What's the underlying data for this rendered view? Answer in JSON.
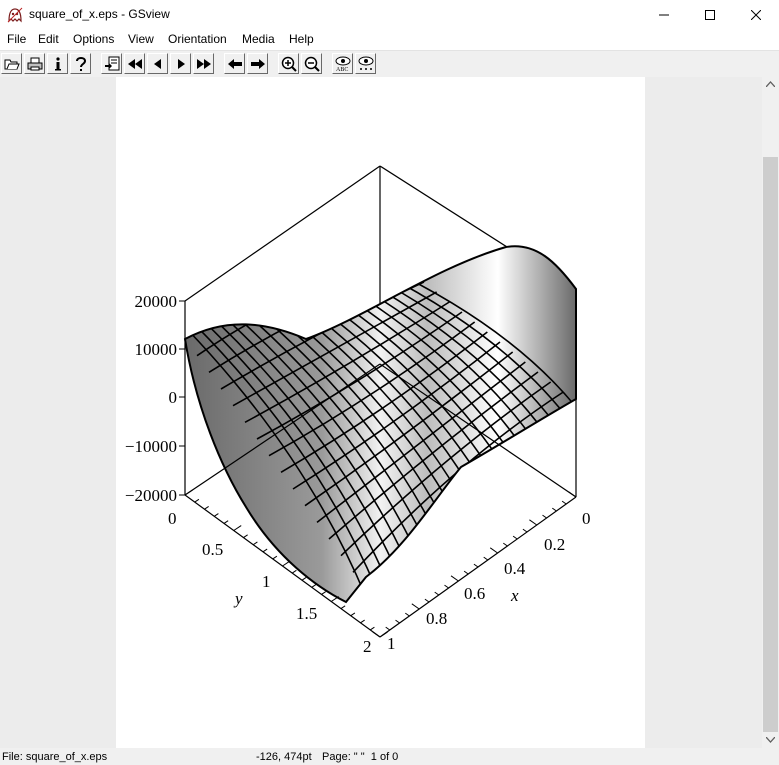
{
  "window": {
    "title": "square_of_x.eps - GSview"
  },
  "menu": [
    "File",
    "Edit",
    "Options",
    "View",
    "Orientation",
    "Media",
    "Help"
  ],
  "toolbar": {
    "buttons": [
      "open-icon",
      "print-icon",
      "info-icon",
      "help-icon",
      "goto-page-icon",
      "first-page-icon",
      "prev-page-icon",
      "next-page-icon",
      "last-page-icon",
      "back-icon",
      "forward-icon",
      "zoom-in-icon",
      "zoom-out-icon",
      "eye-text-icon",
      "eye-dots-icon"
    ]
  },
  "plot": {
    "z_ticks": [
      "20000",
      "10000",
      "0",
      "−10000",
      "−20000"
    ],
    "y_ticks": [
      "0",
      "0.5",
      "1",
      "1.5",
      "2"
    ],
    "x_ticks": [
      "0",
      "0.2",
      "0.4",
      "0.6",
      "0.8",
      "1"
    ],
    "y_label": "y",
    "x_label": "x",
    "surface_color": "#7a7a7a"
  },
  "status": {
    "file": "File: square_of_x.eps",
    "coords": "-126, 474pt",
    "page": "Page: \" \"  1 of 0"
  }
}
